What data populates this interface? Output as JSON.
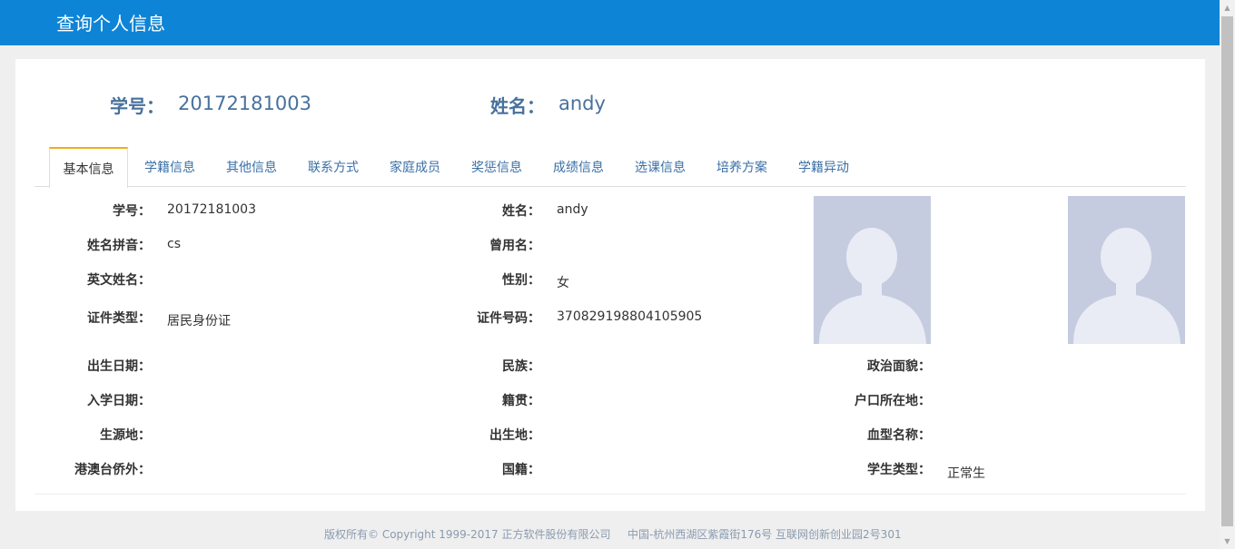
{
  "header": {
    "title": "查询个人信息"
  },
  "summary": {
    "id_label": "学号：",
    "id_value": "20172181003",
    "name_label": "姓名：",
    "name_value": "andy"
  },
  "tabs": [
    {
      "label": "基本信息",
      "active": true
    },
    {
      "label": "学籍信息"
    },
    {
      "label": "其他信息"
    },
    {
      "label": "联系方式"
    },
    {
      "label": "家庭成员"
    },
    {
      "label": "奖惩信息"
    },
    {
      "label": "成绩信息"
    },
    {
      "label": "选课信息"
    },
    {
      "label": "培养方案"
    },
    {
      "label": "学籍异动"
    }
  ],
  "fields": {
    "student_id": {
      "label": "学号：",
      "value": "20172181003"
    },
    "name": {
      "label": "姓名：",
      "value": "andy"
    },
    "pinyin": {
      "label": "姓名拼音：",
      "value": "cs"
    },
    "former_name": {
      "label": "曾用名：",
      "value": ""
    },
    "english_name": {
      "label": "英文姓名：",
      "value": ""
    },
    "gender": {
      "label": "性别：",
      "value": "女"
    },
    "id_type": {
      "label": "证件类型：",
      "value": "居民身份证"
    },
    "id_number": {
      "label": "证件号码：",
      "value": "370829198804105905"
    },
    "birth_date": {
      "label": "出生日期：",
      "value": ""
    },
    "ethnicity": {
      "label": "民族：",
      "value": ""
    },
    "political_status": {
      "label": "政治面貌：",
      "value": ""
    },
    "enroll_date": {
      "label": "入学日期：",
      "value": ""
    },
    "native_place": {
      "label": "籍贯：",
      "value": ""
    },
    "household_location": {
      "label": "户口所在地：",
      "value": ""
    },
    "origin": {
      "label": "生源地：",
      "value": ""
    },
    "birthplace": {
      "label": "出生地：",
      "value": ""
    },
    "blood_type": {
      "label": "血型名称：",
      "value": ""
    },
    "overseas_chinese": {
      "label": "港澳台侨外：",
      "value": ""
    },
    "nationality": {
      "label": "国籍：",
      "value": ""
    },
    "student_type": {
      "label": "学生类型：",
      "value": "正常生"
    }
  },
  "footer": {
    "copyright": "版权所有© Copyright 1999-2017 正方软件股份有限公司",
    "address": "中国-杭州西湖区紫霞街176号 互联网创新创业园2号301"
  },
  "colors": {
    "topbar": "#0e84d6",
    "accent_text": "#48719c",
    "tab_text": "#3a6fa6",
    "active_tab_top": "#f0ad1e",
    "photo_bg": "#c5cce0"
  }
}
